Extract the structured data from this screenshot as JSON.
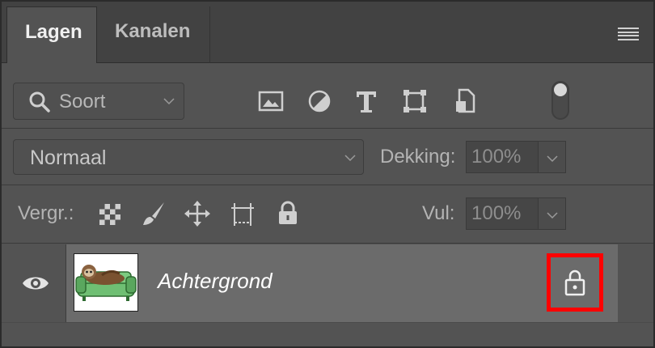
{
  "tabs": [
    {
      "label": "Lagen",
      "active": true
    },
    {
      "label": "Kanalen",
      "active": false
    }
  ],
  "filter": {
    "search_label": "Soort",
    "icons": [
      "image-filter-icon",
      "adjustment-filter-icon",
      "type-filter-icon",
      "shape-filter-icon",
      "smart-object-filter-icon"
    ]
  },
  "blend": {
    "mode": "Normaal",
    "opacity_label": "Dekking:",
    "opacity_value": "100%"
  },
  "lock": {
    "label": "Vergr.:",
    "fill_label": "Vul:",
    "fill_value": "100%",
    "icons": [
      "lock-transparent-pixels-icon",
      "lock-image-pixels-icon",
      "lock-position-icon",
      "lock-artboard-icon",
      "lock-all-icon"
    ]
  },
  "layers": [
    {
      "name": "Achtergrond",
      "visible": true,
      "locked": true
    }
  ],
  "colors": {
    "panel_bg": "#535353",
    "tabbar_bg": "#424242",
    "selected_layer_bg": "#6b6b6b",
    "highlight": "#ff0000"
  }
}
